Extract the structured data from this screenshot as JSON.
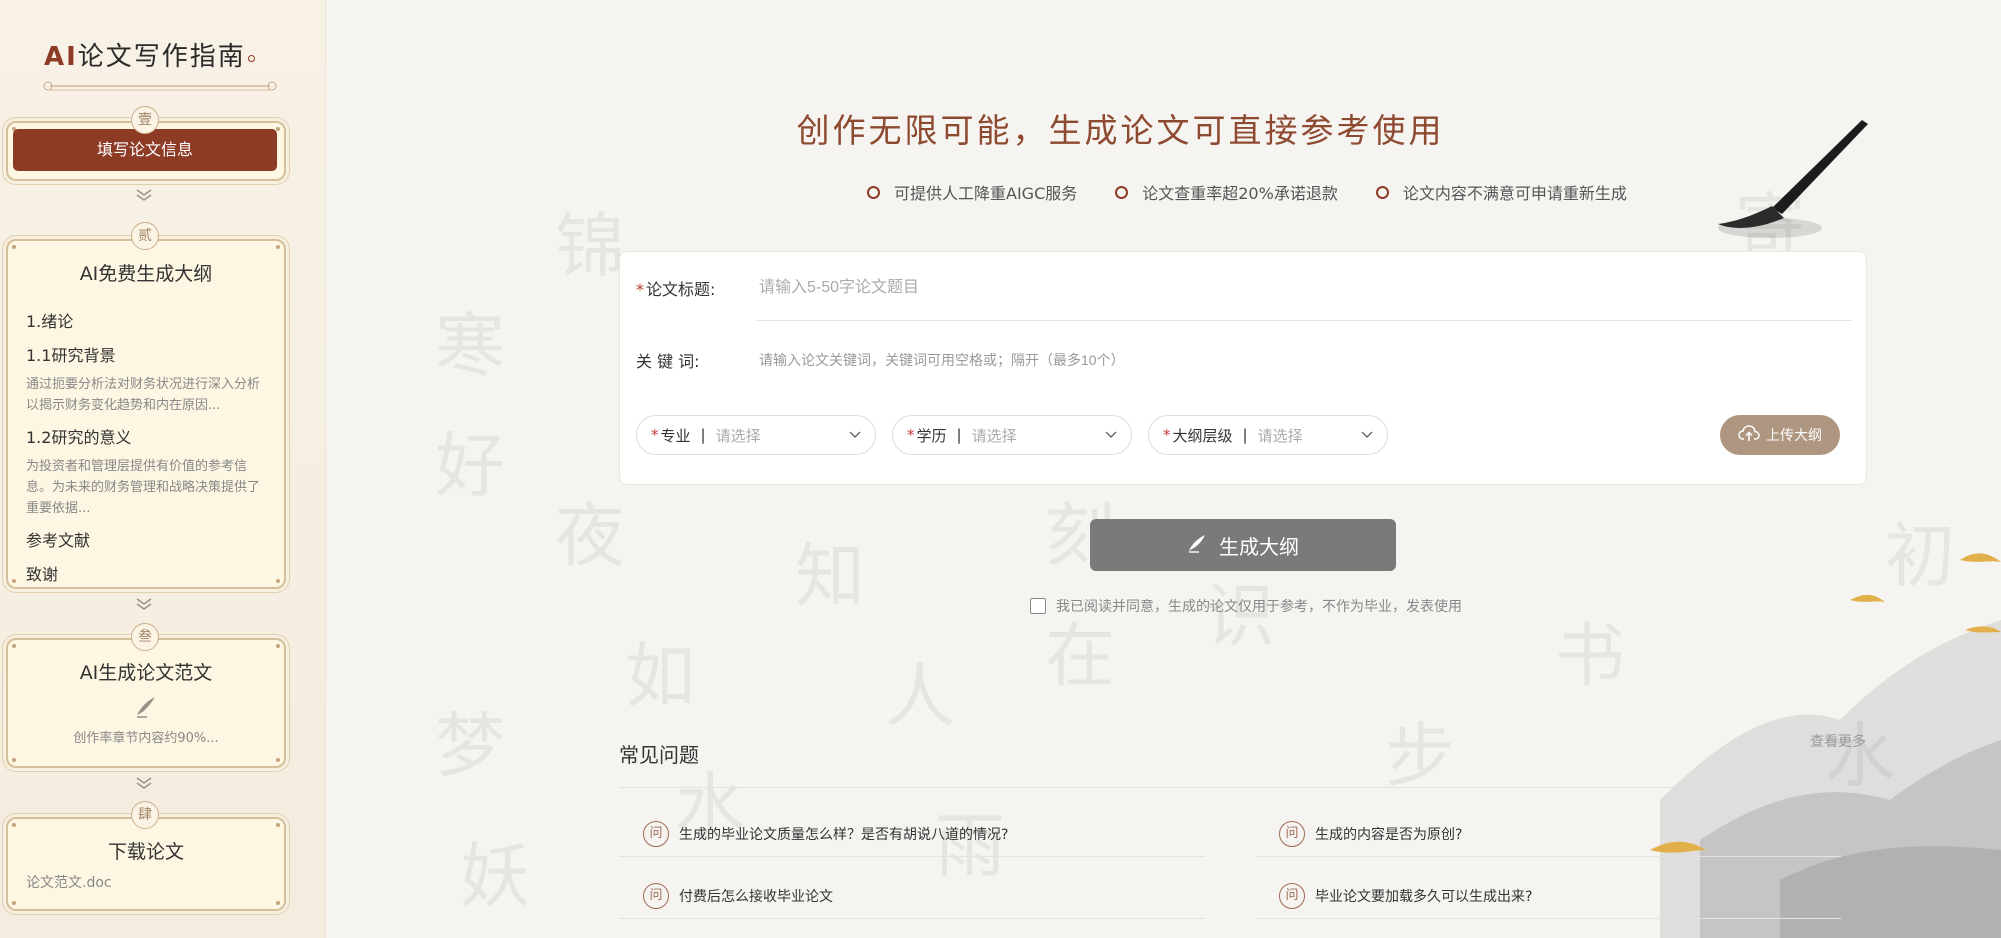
{
  "app": {
    "logo_ai": "AI",
    "logo_text": "论文写作指南"
  },
  "sidebar": {
    "steps": [
      {
        "badge": "壹",
        "label": "填写论文信息"
      },
      {
        "badge": "贰",
        "title": "AI免费生成大纲"
      },
      {
        "badge": "叁",
        "title": "AI生成论文范文",
        "desc": "创作率章节内容约90%..."
      },
      {
        "badge": "肆",
        "title": "下载论文",
        "file": "论文范文.doc"
      }
    ],
    "outline": [
      {
        "heading": "1.绪论"
      },
      {
        "heading": "1.1研究背景",
        "text": "通过扼要分析法对财务状况进行深入分析以揭示财务变化趋势和内在原因..."
      },
      {
        "heading": "1.2研究的意义",
        "text": "为投资者和管理层提供有价值的参考信息。为未来的财务管理和战略决策提供了重要依据..."
      },
      {
        "heading": "参考文献"
      },
      {
        "heading": "致谢"
      }
    ]
  },
  "hero": {
    "title": "创作无限可能，生成论文可直接参考使用",
    "features": [
      "可提供人工降重AIGC服务",
      "论文查重率超20%承诺退款",
      "论文内容不满意可申请重新生成"
    ]
  },
  "form": {
    "title_label": "论文标题:",
    "title_placeholder": "请输入5-50字论文题目",
    "keyword_label": "关 键 词:",
    "keyword_placeholder": "请输入论文关键词，关键词可用空格或；隔开（最多10个）",
    "selects": [
      {
        "label": "专业",
        "placeholder": "请选择"
      },
      {
        "label": "学历",
        "placeholder": "请选择"
      },
      {
        "label": "大纲层级",
        "placeholder": "请选择"
      }
    ],
    "upload_label": "上传大纲",
    "generate_label": "生成大纲",
    "agree_text": "我已阅读并同意，生成的论文仅用于参考，不作为毕业，发表使用"
  },
  "faq": {
    "title": "常见问题",
    "more": "查看更多",
    "badge": "问",
    "items": [
      "生成的毕业论文质量怎么样？是否有胡说八道的情况?",
      "生成的内容是否为原创?",
      "付费后怎么接收毕业论文",
      "毕业论文要加载多久可以生成出来?"
    ]
  },
  "colors": {
    "accent": "#8e3b26",
    "hero_title": "#8e4a30",
    "generate_btn": "#7a7a7a",
    "upload_btn": "#ae9680"
  }
}
